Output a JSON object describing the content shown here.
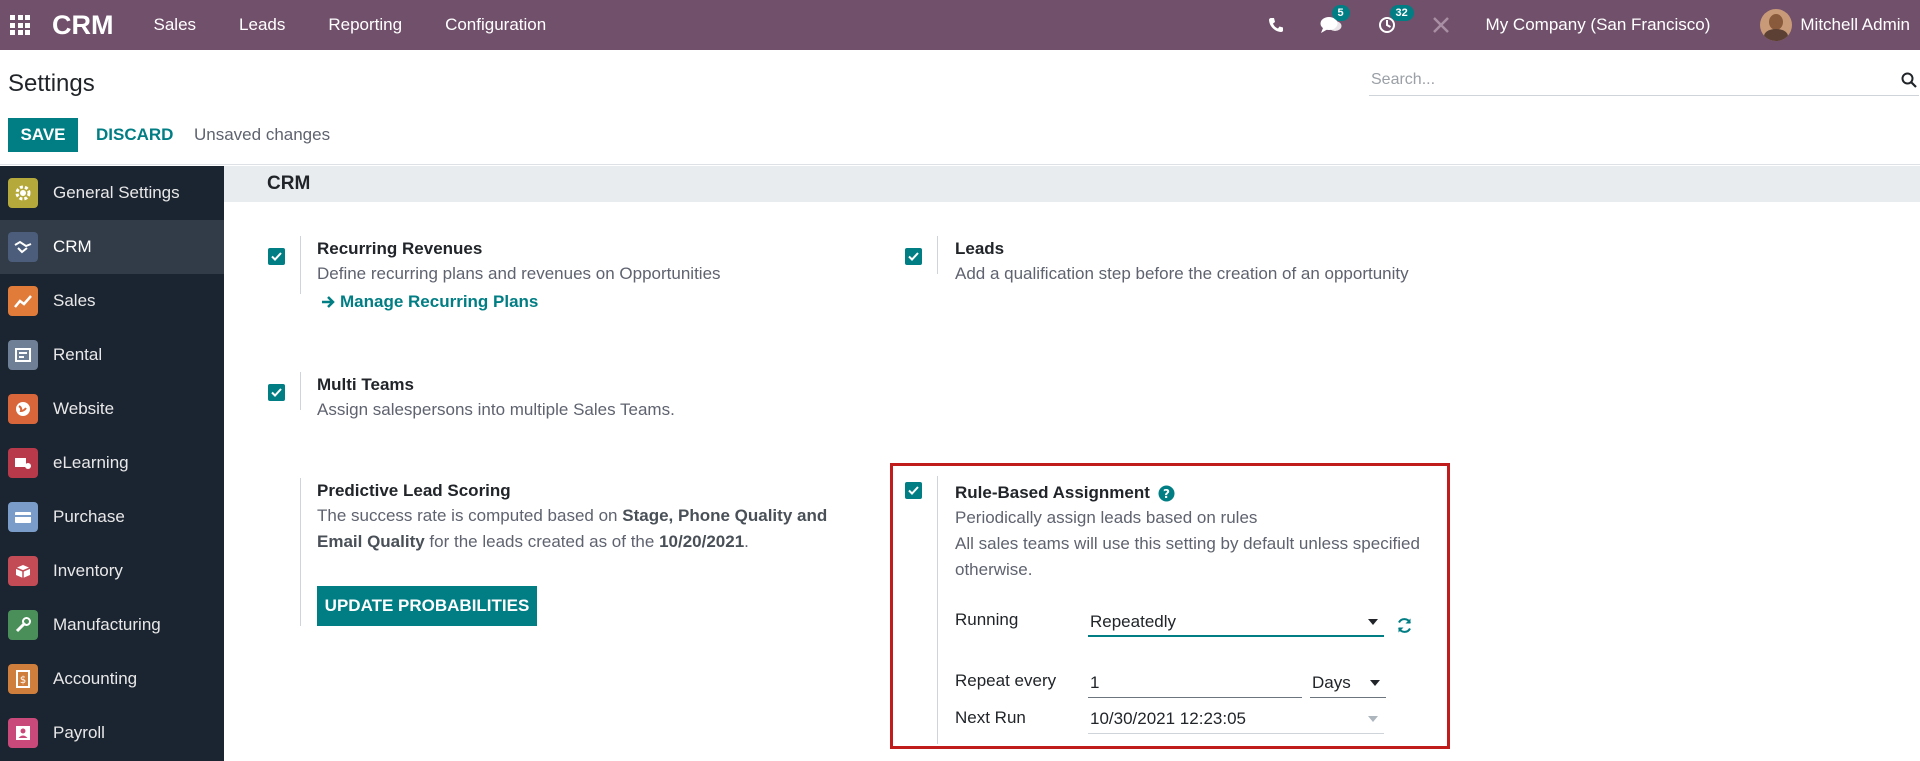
{
  "navbar": {
    "brand": "CRM",
    "menu": [
      "Sales",
      "Leads",
      "Reporting",
      "Configuration"
    ],
    "messages_count": "5",
    "activities_count": "32",
    "company": "My Company (San Francisco)",
    "user": "Mitchell Admin"
  },
  "control_panel": {
    "title": "Settings",
    "search_placeholder": "Search...",
    "save_label": "SAVE",
    "discard_label": "DISCARD",
    "status": "Unsaved changes"
  },
  "sidebar": {
    "items": [
      {
        "label": "General Settings",
        "icon": "gear-icon",
        "color": "#b5a93b"
      },
      {
        "label": "CRM",
        "icon": "handshake-icon",
        "color": "#4b5d7a"
      },
      {
        "label": "Sales",
        "icon": "chart-icon",
        "color": "#e07b39"
      },
      {
        "label": "Rental",
        "icon": "rental-icon",
        "color": "#6f7f95"
      },
      {
        "label": "Website",
        "icon": "globe-icon",
        "color": "#d9663a"
      },
      {
        "label": "eLearning",
        "icon": "elearning-icon",
        "color": "#b8394a"
      },
      {
        "label": "Purchase",
        "icon": "card-icon",
        "color": "#7a9cc9"
      },
      {
        "label": "Inventory",
        "icon": "box-icon",
        "color": "#c24b56"
      },
      {
        "label": "Manufacturing",
        "icon": "wrench-icon",
        "color": "#4a8f5a"
      },
      {
        "label": "Accounting",
        "icon": "invoice-icon",
        "color": "#d07e3c"
      },
      {
        "label": "Payroll",
        "icon": "payroll-icon",
        "color": "#c94a7a"
      }
    ]
  },
  "main": {
    "section_title": "CRM",
    "recurring": {
      "title": "Recurring Revenues",
      "desc": "Define recurring plans and revenues on Opportunities",
      "link": "Manage Recurring Plans"
    },
    "leads": {
      "title": "Leads",
      "desc": "Add a qualification step before the creation of an opportunity"
    },
    "multi_teams": {
      "title": "Multi Teams",
      "desc": "Assign salespersons into multiple Sales Teams."
    },
    "predictive": {
      "title": "Predictive Lead Scoring",
      "desc_1": "The success rate is computed based on ",
      "desc_bold": "Stage, Phone Quality and Email Quality",
      "desc_2": " for the leads created as of the ",
      "date": "10/20/2021",
      "desc_3": ".",
      "button": "UPDATE PROBABILITIES"
    },
    "rule_based": {
      "title": "Rule-Based Assignment",
      "desc": "Periodically assign leads based on rules",
      "note": "All sales teams will use this setting by default unless specified otherwise.",
      "running_label": "Running",
      "running_value": "Repeatedly",
      "repeat_label": "Repeat every",
      "repeat_value": "1",
      "repeat_unit": "Days",
      "next_run_label": "Next Run",
      "next_run_value": "10/30/2021 12:23:05"
    }
  }
}
